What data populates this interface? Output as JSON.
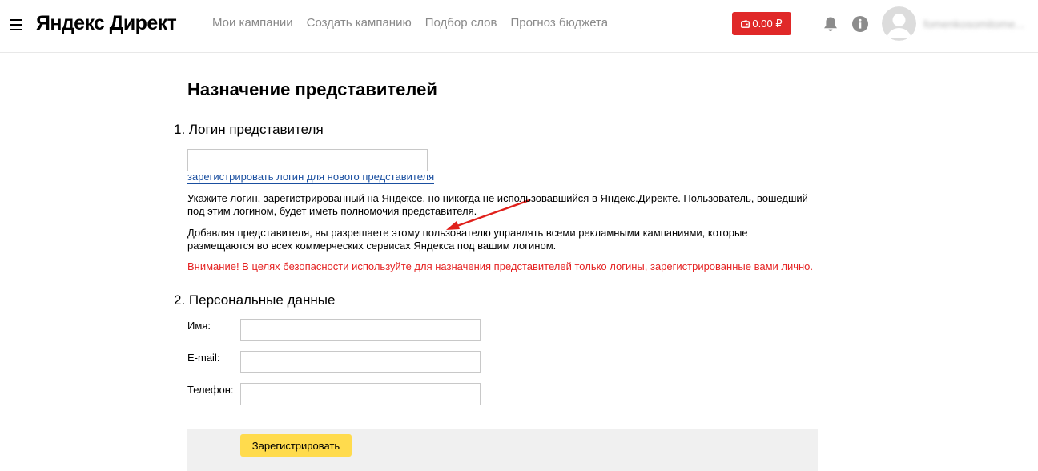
{
  "header": {
    "logo": "Яндекс Директ",
    "nav": [
      "Мои кампании",
      "Создать кампанию",
      "Подбор слов",
      "Прогноз бюджета"
    ],
    "balance": "0.00 ₽",
    "username": "fomenkosomitome..."
  },
  "page": {
    "title": "Назначение представителей",
    "section1": {
      "title": "1. Логин представителя",
      "login_value": "",
      "register_link": "зарегистрировать логин для нового представителя",
      "note1_line1": "Укажите логин, зарегистрированный на Яндексе, но никогда не использовавшийся в Яндекс.Директе. Пользователь, вошедший",
      "note1_line2": "под этим логином, будет иметь полномочия представителя.",
      "note2_line1": "Добавляя представителя, вы разрешаете этому пользователю управлять всеми рекламными кампаниями, которые",
      "note2_line2": "размещаются во всех коммерческих сервисах Яндекса под вашим логином.",
      "warning": "Внимание! В целях безопасности используйте для назначения представителей только логины, зарегистрированные вами лично."
    },
    "section2": {
      "title": "2. Персональные данные",
      "name_label": "Имя:",
      "email_label": "E-mail:",
      "phone_label": "Телефон:",
      "name_value": "",
      "email_value": "",
      "phone_value": ""
    },
    "submit_label": "Зарегистрировать"
  },
  "colors": {
    "balance_bg": "#e02828",
    "link": "#1a4fa0",
    "warning": "#e52222",
    "submit_bg": "#ffdb4d",
    "annotation_arrow": "#e0201b"
  },
  "icons": [
    "menu-icon",
    "wallet-icon",
    "bell-icon",
    "info-icon",
    "avatar-icon"
  ]
}
